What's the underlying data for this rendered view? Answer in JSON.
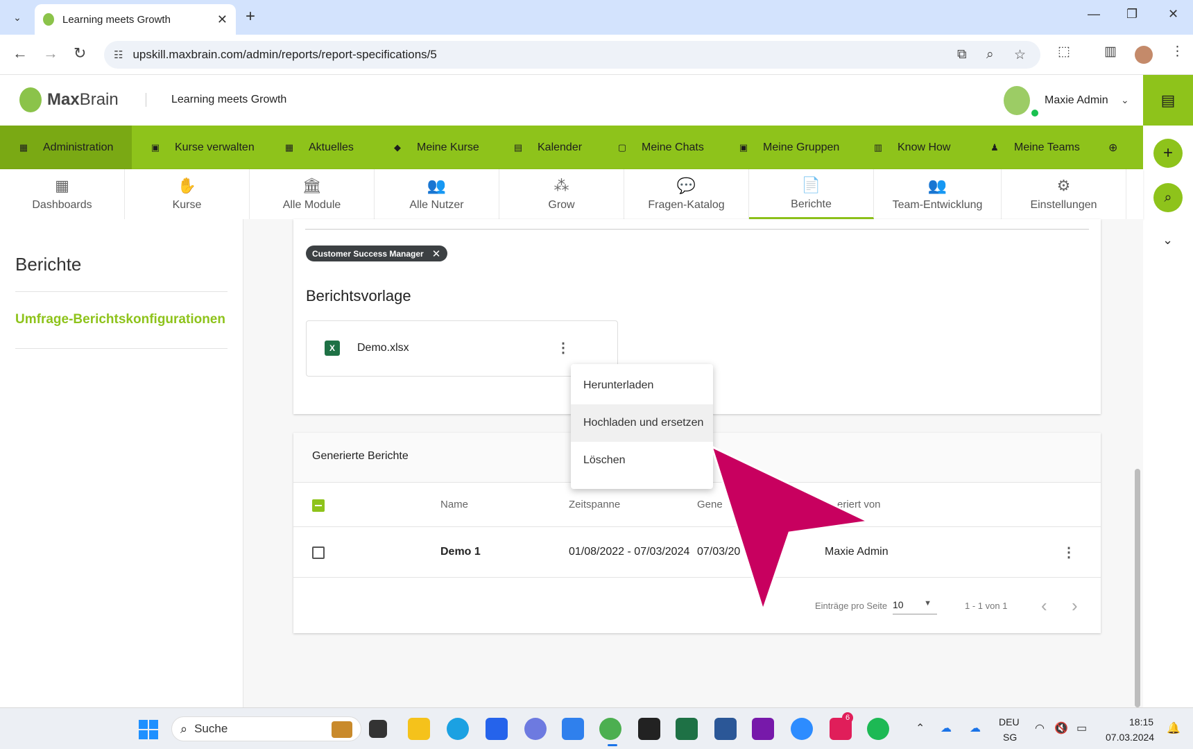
{
  "browser": {
    "tab_title": "Learning meets Growth",
    "url": "upskill.maxbrain.com/admin/reports/report-specifications/5",
    "new_tab": "+",
    "tab_close": "✕",
    "minimize": "—",
    "restore": "❐",
    "close": "✕"
  },
  "header": {
    "logo_bold": "Max",
    "logo_light": "Brain",
    "tagline": "Learning meets Growth",
    "user_name": "Maxie Admin"
  },
  "main_nav": [
    {
      "label": "Administration",
      "icon": "dashboard-icon",
      "glyph": "▦"
    },
    {
      "label": "Kurse verwalten",
      "icon": "folder-icon",
      "glyph": "▣"
    },
    {
      "label": "Aktuelles",
      "icon": "news-icon",
      "glyph": "▦"
    },
    {
      "label": "Meine Kurse",
      "icon": "graduation-cap-icon",
      "glyph": "◆"
    },
    {
      "label": "Kalender",
      "icon": "calendar-icon",
      "glyph": "▤"
    },
    {
      "label": "Meine Chats",
      "icon": "chat-icon",
      "glyph": "▢"
    },
    {
      "label": "Meine Gruppen",
      "icon": "group-folder-icon",
      "glyph": "▣"
    },
    {
      "label": "Know How",
      "icon": "book-icon",
      "glyph": "▥"
    },
    {
      "label": "Meine Teams",
      "icon": "team-icon",
      "glyph": "♟"
    }
  ],
  "sub_nav": [
    {
      "label": "Dashboards",
      "icon": "dashboard-icon",
      "glyph": "▦"
    },
    {
      "label": "Kurse",
      "icon": "courses-icon",
      "glyph": "✋"
    },
    {
      "label": "Alle Module",
      "icon": "institution-icon",
      "glyph": "🏛"
    },
    {
      "label": "Alle Nutzer",
      "icon": "users-icon",
      "glyph": "👥"
    },
    {
      "label": "Grow",
      "icon": "grow-icon",
      "glyph": "⁂"
    },
    {
      "label": "Fragen-Katalog",
      "icon": "question-catalog-icon",
      "glyph": "💬"
    },
    {
      "label": "Berichte",
      "icon": "report-icon",
      "glyph": "📄"
    },
    {
      "label": "Team-Entwicklung",
      "icon": "team-development-icon",
      "glyph": "👥"
    },
    {
      "label": "Einstellungen",
      "icon": "settings-icon",
      "glyph": "⚙"
    }
  ],
  "left_panel": {
    "title": "Berichte",
    "link": "Umfrage-Berichtskonfigurationen"
  },
  "report": {
    "chip": "Customer Success Manager",
    "section_title": "Berichtsvorlage",
    "file_name": "Demo.xlsx",
    "file_icon_letter": "X"
  },
  "menu": {
    "items": [
      "Herunterladen",
      "Hochladen und ersetzen",
      "Löschen"
    ]
  },
  "generated": {
    "title": "Generierte Berichte",
    "columns": {
      "name": "Name",
      "period": "Zeitspanne",
      "generated_on": "Gene",
      "generated_by": "eriert von"
    },
    "rows": [
      {
        "name": "Demo 1",
        "period": "01/08/2022 - 07/03/2024",
        "generated_on": "07/03/20",
        "generated_by": "Maxie Admin"
      }
    ],
    "pager": {
      "per_page_label": "Einträge pro Seite",
      "per_page_value": "10",
      "range": "1 - 1 von 1"
    }
  },
  "taskbar": {
    "search_text": "Suche",
    "lang": "DEU",
    "region": "SG",
    "time": "18:15",
    "date": "07.03.2024",
    "slack_badge": "6"
  },
  "colors": {
    "brand_green": "#8ec31b",
    "arrow_magenta": "#c8005f"
  }
}
